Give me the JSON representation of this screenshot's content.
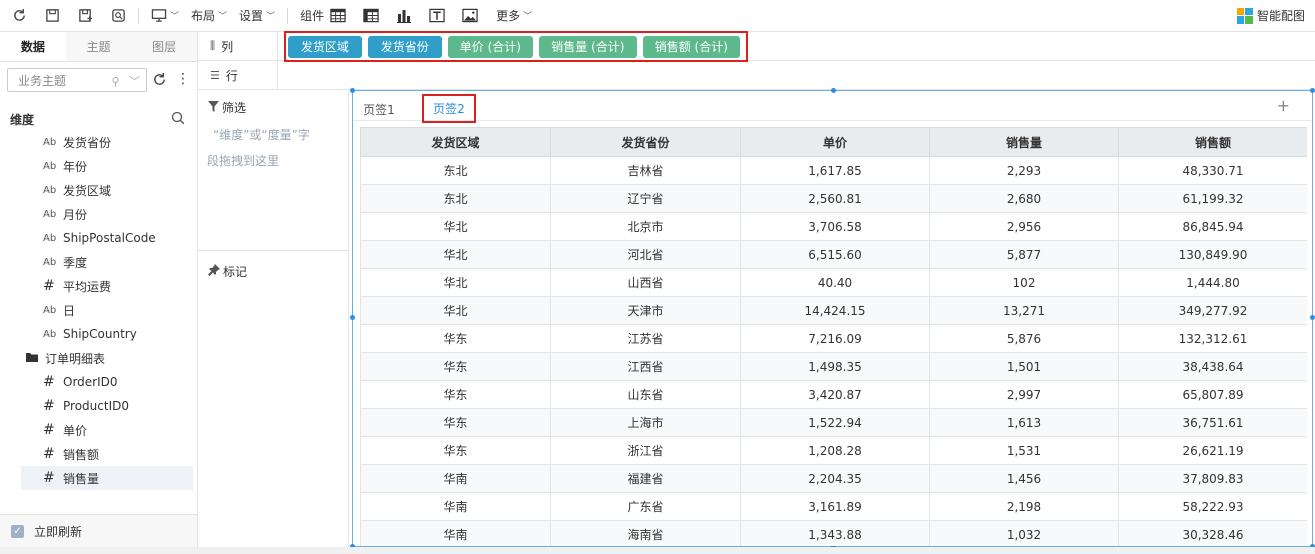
{
  "toolbar": {
    "layout_label": "布局",
    "settings_label": "设置",
    "component_label": "组件",
    "more_label": "更多",
    "smart_label": "智能配图"
  },
  "left_panel": {
    "tabs": [
      "数据",
      "主题",
      "图层"
    ],
    "active_tab": "数据",
    "topic_placeholder": "业务主题",
    "dimension_title": "维度",
    "fields": [
      {
        "type": "text",
        "label": "发货省份"
      },
      {
        "type": "text",
        "label": "年份"
      },
      {
        "type": "text",
        "label": "发货区域"
      },
      {
        "type": "text",
        "label": "月份"
      },
      {
        "type": "text",
        "label": "ShipPostalCode"
      },
      {
        "type": "text",
        "label": "季度"
      },
      {
        "type": "number",
        "label": "平均运费"
      },
      {
        "type": "text",
        "label": "日"
      },
      {
        "type": "text",
        "label": "ShipCountry"
      },
      {
        "type": "folder",
        "label": "订单明细表"
      },
      {
        "type": "number",
        "label": "OrderID0"
      },
      {
        "type": "number",
        "label": "ProductID0"
      },
      {
        "type": "number",
        "label": "单价"
      },
      {
        "type": "number",
        "label": "销售额"
      },
      {
        "type": "number",
        "label": "销售量"
      }
    ],
    "selected_field": "销售量",
    "refresh_label": "立即刷新"
  },
  "shelves": {
    "column_label": "列",
    "row_label": "行",
    "column_pills": [
      {
        "label": "发货区域",
        "kind": "dimension"
      },
      {
        "label": "发货省份",
        "kind": "dimension"
      },
      {
        "label": "单价 (合计)",
        "kind": "measure"
      },
      {
        "label": "销售量 (合计)",
        "kind": "measure"
      },
      {
        "label": "销售额 (合计)",
        "kind": "measure"
      }
    ]
  },
  "filter": {
    "title": "筛选",
    "hint_line1": "“维度”或“度量”字",
    "hint_line2": "段拖拽到这里"
  },
  "mark": {
    "title": "标记"
  },
  "canvas": {
    "tabs": [
      "页签1",
      "页签2"
    ],
    "active_tab": "页签2",
    "table": {
      "headers": [
        "发货区域",
        "发货省份",
        "单价",
        "销售量",
        "销售额"
      ],
      "rows": [
        [
          "东北",
          "吉林省",
          "1,617.85",
          "2,293",
          "48,330.71"
        ],
        [
          "东北",
          "辽宁省",
          "2,560.81",
          "2,680",
          "61,199.32"
        ],
        [
          "华北",
          "北京市",
          "3,706.58",
          "2,956",
          "86,845.94"
        ],
        [
          "华北",
          "河北省",
          "6,515.60",
          "5,877",
          "130,849.90"
        ],
        [
          "华北",
          "山西省",
          "40.40",
          "102",
          "1,444.80"
        ],
        [
          "华北",
          "天津市",
          "14,424.15",
          "13,271",
          "349,277.92"
        ],
        [
          "华东",
          "江苏省",
          "7,216.09",
          "5,876",
          "132,312.61"
        ],
        [
          "华东",
          "江西省",
          "1,498.35",
          "1,501",
          "38,438.64"
        ],
        [
          "华东",
          "山东省",
          "3,420.87",
          "2,997",
          "65,807.89"
        ],
        [
          "华东",
          "上海市",
          "1,522.94",
          "1,613",
          "36,751.61"
        ],
        [
          "华东",
          "浙江省",
          "1,208.28",
          "1,531",
          "26,621.19"
        ],
        [
          "华南",
          "福建省",
          "2,204.35",
          "1,456",
          "37,809.83"
        ],
        [
          "华南",
          "广东省",
          "3,161.89",
          "2,198",
          "58,222.93"
        ],
        [
          "华南",
          "海南省",
          "1,343.88",
          "1,032",
          "30,328.46"
        ]
      ]
    }
  },
  "colors": {
    "dimension_pill": "#2f9fc9",
    "measure_pill": "#5db98b",
    "highlight_box": "#d9211d",
    "accent": "#2b8ee0"
  }
}
